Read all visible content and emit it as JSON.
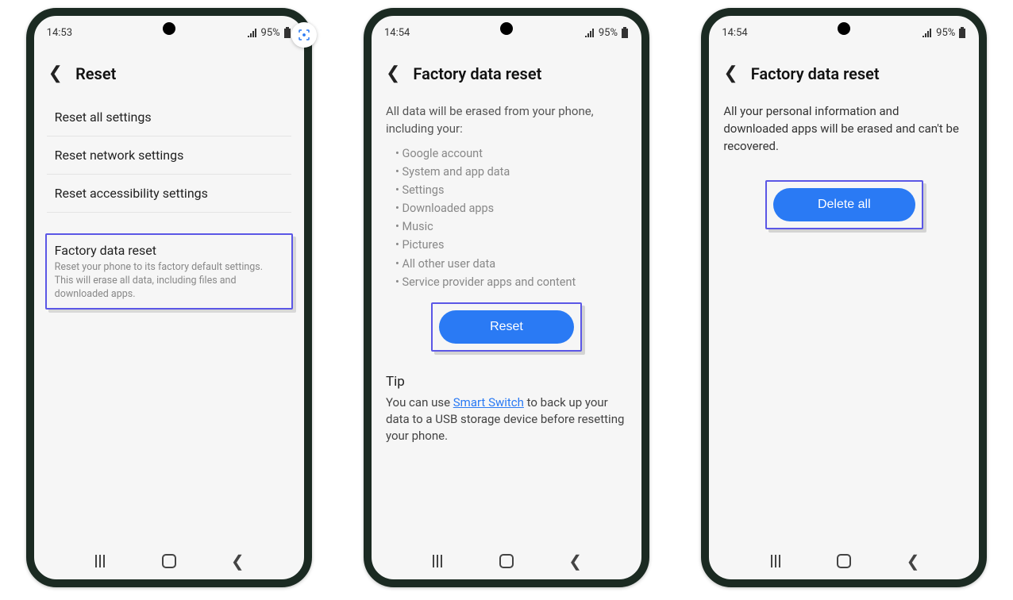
{
  "phone1": {
    "time": "14:53",
    "battery": "95%",
    "header": "Reset",
    "items": [
      "Reset all settings",
      "Reset network settings",
      "Reset accessibility settings"
    ],
    "factory": {
      "title": "Factory data reset",
      "subtitle": "Reset your phone to its factory default settings. This will erase all data, including files and downloaded apps."
    }
  },
  "phone2": {
    "time": "14:54",
    "battery": "95%",
    "header": "Factory data reset",
    "intro": "All data will be erased from your phone, including your:",
    "bullets": [
      "Google account",
      "System and app data",
      "Settings",
      "Downloaded apps",
      "Music",
      "Pictures",
      "All other user data",
      "Service provider apps and content"
    ],
    "button": "Reset",
    "tip_heading": "Tip",
    "tip_before": "You can use ",
    "tip_link": "Smart Switch",
    "tip_after": " to back up your data to a USB storage device before resetting your phone."
  },
  "phone3": {
    "time": "14:54",
    "battery": "95%",
    "header": "Factory data reset",
    "body": "All your personal information and downloaded apps will be erased and can't be recovered.",
    "button": "Delete all"
  }
}
